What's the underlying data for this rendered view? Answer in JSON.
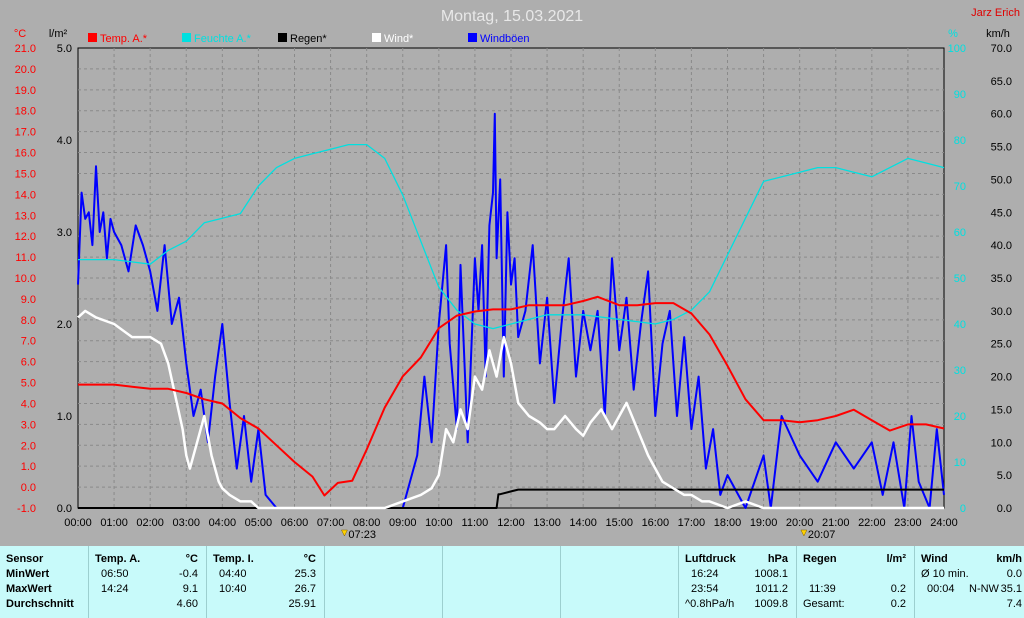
{
  "title": "Montag, 15.03.2021",
  "author": "Jarz Erich",
  "units": {
    "temp": "°C",
    "rain": "l/m²",
    "hum": "%",
    "wind": "km/h"
  },
  "legend": [
    {
      "label": "Temp. A.*",
      "color": "#ff0000"
    },
    {
      "label": "Feuchte A.*",
      "color": "#00e0e0"
    },
    {
      "label": "Regen*",
      "color": "#000000"
    },
    {
      "label": "Wind*",
      "color": "#ffffff"
    },
    {
      "label": "Windböen",
      "color": "#0000ff"
    }
  ],
  "sun": {
    "rise": "07:23",
    "set": "20:07"
  },
  "chart_data": {
    "type": "line",
    "x_unit": "hour of day",
    "xlim": [
      0,
      24
    ],
    "x_ticks": [
      "00:00",
      "01:00",
      "02:00",
      "03:00",
      "04:00",
      "05:00",
      "06:00",
      "07:00",
      "08:00",
      "09:00",
      "10:00",
      "11:00",
      "12:00",
      "13:00",
      "14:00",
      "15:00",
      "16:00",
      "17:00",
      "18:00",
      "19:00",
      "20:00",
      "21:00",
      "22:00",
      "23:00",
      "24:00"
    ],
    "axes": {
      "temp": {
        "label": "°C",
        "ylim": [
          -1,
          21
        ],
        "ticks": [
          "21.0",
          "20.0",
          "19.0",
          "18.0",
          "17.0",
          "16.0",
          "15.0",
          "14.0",
          "13.0",
          "12.0",
          "11.0",
          "10.0",
          "9.0",
          "8.0",
          "7.0",
          "6.0",
          "5.0",
          "4.0",
          "3.0",
          "2.0",
          "1.0",
          "0.0",
          "-1.0"
        ]
      },
      "rain": {
        "label": "l/m²",
        "ylim": [
          0,
          5
        ],
        "ticks": [
          "5.0",
          "4.0",
          "3.0",
          "2.0",
          "1.0",
          "0.0"
        ]
      },
      "hum": {
        "label": "%",
        "ylim": [
          0,
          100
        ],
        "ticks": [
          "100",
          "90",
          "80",
          "70",
          "60",
          "50",
          "40",
          "30",
          "20",
          "10",
          "0"
        ]
      },
      "wind": {
        "label": "km/h",
        "ylim": [
          0,
          70
        ],
        "ticks": [
          "70.0",
          "65.0",
          "60.0",
          "55.0",
          "50.0",
          "45.0",
          "40.0",
          "35.0",
          "30.0",
          "25.0",
          "20.0",
          "15.0",
          "10.0",
          "5.0",
          "0.0"
        ]
      }
    },
    "series": [
      {
        "name": "Temp. A.*",
        "axis": "temp",
        "color": "#ff0000",
        "x": [
          0,
          1,
          1.5,
          2,
          2.5,
          3,
          3.5,
          4,
          4.5,
          5,
          5.5,
          6,
          6.5,
          6.83,
          7.2,
          7.6,
          8,
          8.5,
          9,
          9.5,
          10,
          10.5,
          11,
          11.5,
          12,
          12.5,
          13,
          13.5,
          14,
          14.4,
          15,
          15.5,
          16,
          16.5,
          17,
          17.5,
          18,
          18.5,
          19,
          19.5,
          20,
          20.5,
          21,
          21.5,
          22,
          22.5,
          23,
          23.5,
          24
        ],
        "y": [
          4.9,
          4.9,
          4.8,
          4.7,
          4.7,
          4.5,
          4.2,
          4.0,
          3.3,
          2.8,
          2.0,
          1.2,
          0.5,
          -0.4,
          0.2,
          0.3,
          1.8,
          3.8,
          5.3,
          6.2,
          7.6,
          8.2,
          8.4,
          8.5,
          8.5,
          8.7,
          8.7,
          8.7,
          8.9,
          9.1,
          8.7,
          8.7,
          8.8,
          8.8,
          8.3,
          7.3,
          5.8,
          4.2,
          3.2,
          3.2,
          3.1,
          3.2,
          3.4,
          3.7,
          3.2,
          2.7,
          3.0,
          3.0,
          2.8
        ]
      },
      {
        "name": "Feuchte A.*",
        "axis": "hum",
        "color": "#00e0e0",
        "x": [
          0,
          1,
          2,
          2.5,
          3,
          3.5,
          4,
          4.5,
          5,
          5.5,
          6,
          6.5,
          7,
          7.5,
          8,
          8.5,
          9,
          9.5,
          10,
          10.5,
          11,
          11.5,
          12,
          12.5,
          13,
          14,
          15,
          16,
          16.5,
          17,
          17.5,
          18,
          18.5,
          19,
          20,
          20.5,
          21,
          21.5,
          22,
          22.5,
          23,
          23.5,
          24
        ],
        "y": [
          54,
          54,
          53,
          56,
          58,
          62,
          63,
          64,
          70,
          74,
          76,
          77,
          78,
          79,
          79,
          76,
          68,
          58,
          48,
          43,
          40,
          39,
          40,
          41,
          42,
          42,
          41,
          40,
          41,
          43,
          47,
          55,
          63,
          71,
          73,
          74,
          74,
          73,
          72,
          74,
          76,
          75,
          74
        ]
      },
      {
        "name": "Regen*",
        "axis": "rain",
        "color": "#000000",
        "x": [
          0,
          11.6,
          11.65,
          11.7,
          12,
          12.2,
          12.5,
          13,
          24
        ],
        "y": [
          0,
          0,
          0.15,
          0.15,
          0.18,
          0.2,
          0.2,
          0.2,
          0.2
        ]
      },
      {
        "name": "Wind*",
        "axis": "wind",
        "color": "#ffffff",
        "x": [
          0,
          0.2,
          0.5,
          1,
          1.5,
          2,
          2.3,
          2.5,
          2.7,
          2.9,
          3,
          3.1,
          3.3,
          3.5,
          3.7,
          3.9,
          4,
          4.2,
          4.5,
          4.8,
          5,
          5.5,
          6,
          7,
          8,
          8.5,
          9,
          9.5,
          9.8,
          10,
          10.2,
          10.4,
          10.6,
          10.8,
          11,
          11.2,
          11.4,
          11.6,
          11.8,
          12,
          12.2,
          12.5,
          12.8,
          13,
          13.2,
          13.5,
          13.8,
          14,
          14.2,
          14.5,
          14.8,
          15,
          15.2,
          15.5,
          15.8,
          16,
          16.2,
          16.5,
          16.8,
          17,
          17.3,
          17.5,
          18,
          18.5,
          19,
          20,
          21,
          22,
          23,
          24
        ],
        "y": [
          29,
          30,
          29,
          28,
          26,
          26,
          25,
          22,
          17,
          12,
          8,
          6,
          10,
          14,
          8,
          4,
          3,
          2,
          1,
          1,
          0,
          0,
          0,
          0,
          0,
          0,
          1,
          2,
          3,
          5,
          12,
          10,
          15,
          12,
          20,
          18,
          24,
          20,
          26,
          22,
          16,
          14,
          13,
          12,
          12,
          14,
          12,
          11,
          13,
          15,
          12,
          14,
          16,
          12,
          8,
          6,
          4,
          3,
          2,
          2,
          1,
          1,
          0,
          1,
          0,
          0,
          0,
          0,
          0,
          0
        ]
      },
      {
        "name": "Windböen",
        "axis": "wind",
        "color": "#0000ff",
        "x": [
          0,
          0.1,
          0.2,
          0.3,
          0.4,
          0.5,
          0.6,
          0.7,
          0.8,
          0.9,
          1,
          1.2,
          1.4,
          1.6,
          1.8,
          2,
          2.2,
          2.4,
          2.6,
          2.8,
          3,
          3.2,
          3.4,
          3.6,
          3.8,
          4,
          4.2,
          4.4,
          4.6,
          4.8,
          5,
          5.2,
          5.5,
          6,
          7,
          8,
          8.5,
          9,
          9.4,
          9.6,
          9.8,
          10,
          10.2,
          10.3,
          10.5,
          10.6,
          10.8,
          11,
          11.1,
          11.2,
          11.3,
          11.4,
          11.5,
          11.55,
          11.6,
          11.7,
          11.8,
          11.9,
          12,
          12.1,
          12.2,
          12.4,
          12.6,
          12.8,
          13,
          13.2,
          13.4,
          13.6,
          13.8,
          14,
          14.2,
          14.4,
          14.6,
          14.8,
          15,
          15.2,
          15.4,
          15.6,
          15.8,
          16,
          16.2,
          16.4,
          16.6,
          16.8,
          17,
          17.2,
          17.4,
          17.6,
          17.8,
          18,
          18.5,
          19,
          19.2,
          19.5,
          20,
          20.5,
          21,
          21.5,
          22,
          22.3,
          22.6,
          22.9,
          23.1,
          23.3,
          23.6,
          23.8,
          24
        ],
        "y": [
          34,
          48,
          44,
          45,
          40,
          52,
          42,
          45,
          38,
          44,
          42,
          40,
          36,
          43,
          40,
          36,
          30,
          40,
          28,
          32,
          22,
          14,
          18,
          10,
          20,
          28,
          16,
          6,
          14,
          4,
          12,
          2,
          0,
          0,
          0,
          0,
          0,
          0,
          8,
          20,
          10,
          28,
          40,
          25,
          12,
          37,
          10,
          38,
          30,
          40,
          20,
          43,
          48,
          60,
          38,
          50,
          20,
          45,
          34,
          38,
          26,
          30,
          40,
          22,
          32,
          16,
          28,
          38,
          20,
          30,
          24,
          30,
          14,
          38,
          24,
          32,
          18,
          28,
          36,
          14,
          25,
          30,
          14,
          26,
          12,
          20,
          6,
          12,
          2,
          5,
          0,
          8,
          0,
          14,
          8,
          4,
          10,
          6,
          10,
          2,
          10,
          0,
          14,
          4,
          0,
          12,
          2
        ]
      }
    ]
  },
  "table": {
    "sensor": {
      "header": "Sensor",
      "rows": [
        "MinWert",
        "MaxWert",
        "Durchschnitt"
      ]
    },
    "temp_a": {
      "header": "Temp. A.",
      "unit": "°C",
      "times": [
        "06:50",
        "14:24",
        ""
      ],
      "values": [
        "-0.4",
        "9.1",
        "4.60"
      ]
    },
    "temp_i": {
      "header": "Temp. I.",
      "unit": "°C",
      "times": [
        "04:40",
        "10:40",
        ""
      ],
      "values": [
        "25.3",
        "26.7",
        "25.91"
      ]
    },
    "pressure": {
      "header": "Luftdruck",
      "unit": "hPa",
      "times": [
        "16:24",
        "23:54",
        "^0.8hPa/h"
      ],
      "values": [
        "1008.1",
        "1011.2",
        "1009.8"
      ]
    },
    "rain": {
      "header": "Regen",
      "unit": "l/m²",
      "times": [
        "",
        "11:39",
        "Gesamt:"
      ],
      "values": [
        "",
        "0.2",
        "0.2"
      ]
    },
    "wind": {
      "header": "Wind",
      "unit": "km/h",
      "times": [
        "Ø 10 min.",
        "00:04",
        ""
      ],
      "dirs": [
        "",
        "N-NW",
        ""
      ],
      "values": [
        "0.0",
        "35.1",
        "7.4"
      ]
    }
  }
}
